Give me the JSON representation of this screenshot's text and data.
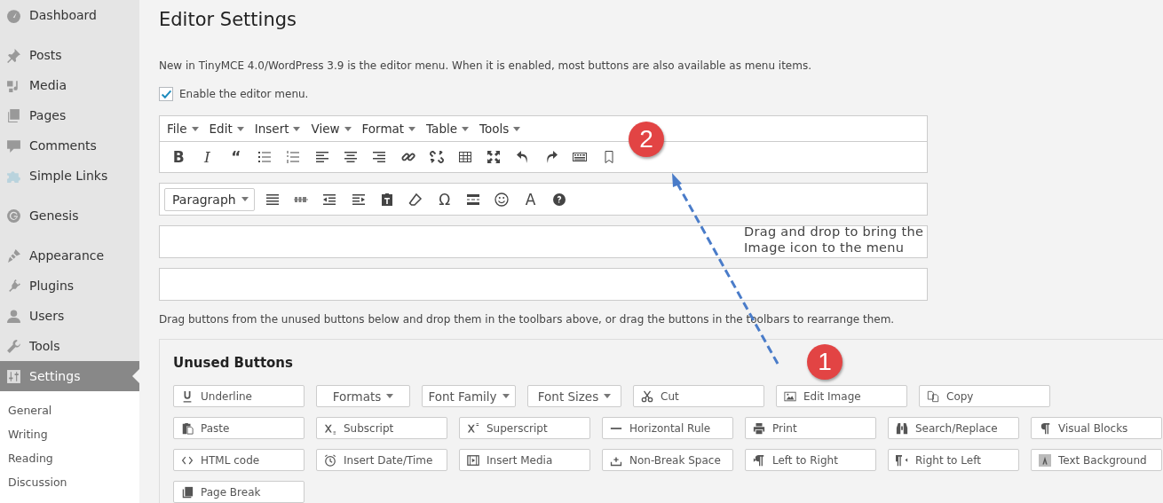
{
  "sidebar": {
    "groups": [
      [
        {
          "label": "Dashboard",
          "selected": false
        }
      ],
      [
        {
          "label": "Posts",
          "selected": false
        },
        {
          "label": "Media",
          "selected": false
        },
        {
          "label": "Pages",
          "selected": false
        },
        {
          "label": "Comments",
          "selected": false
        },
        {
          "label": "Simple Links",
          "selected": false
        }
      ],
      [
        {
          "label": "Genesis",
          "selected": false
        }
      ],
      [
        {
          "label": "Appearance",
          "selected": false
        },
        {
          "label": "Plugins",
          "selected": false
        },
        {
          "label": "Users",
          "selected": false
        },
        {
          "label": "Tools",
          "selected": false
        },
        {
          "label": "Settings",
          "selected": true
        }
      ]
    ],
    "submenu": [
      {
        "label": "General",
        "selected": false
      },
      {
        "label": "Writing",
        "selected": false
      },
      {
        "label": "Reading",
        "selected": false
      },
      {
        "label": "Discussion",
        "selected": false
      }
    ]
  },
  "page": {
    "title": "Editor Settings",
    "description": "New in TinyMCE 4.0/WordPress 3.9 is the editor menu. When it is enabled, most buttons are also available as menu items.",
    "enable_menu": {
      "label": "Enable the editor menu.",
      "checked": true
    },
    "menubar": [
      "File",
      "Edit",
      "Insert",
      "View",
      "Format",
      "Table",
      "Tools"
    ],
    "toolbar_1": [
      {
        "kind": "glyph",
        "text": "B"
      },
      {
        "kind": "glyph",
        "text": "I"
      },
      {
        "kind": "glyph",
        "text": "“"
      },
      {
        "kind": "icon"
      },
      {
        "kind": "icon"
      },
      {
        "kind": "icon"
      },
      {
        "kind": "icon"
      },
      {
        "kind": "icon"
      },
      {
        "kind": "icon"
      },
      {
        "kind": "icon"
      },
      {
        "kind": "icon"
      },
      {
        "kind": "icon"
      },
      {
        "kind": "icon"
      },
      {
        "kind": "icon"
      },
      {
        "kind": "icon"
      },
      {
        "kind": "icon"
      }
    ],
    "toolbar_2": [
      {
        "kind": "select",
        "text": "Paragraph"
      },
      {
        "kind": "icon"
      },
      {
        "kind": "icon"
      },
      {
        "kind": "icon"
      },
      {
        "kind": "icon"
      },
      {
        "kind": "icon"
      },
      {
        "kind": "icon"
      },
      {
        "kind": "glyph",
        "text": "Ω"
      },
      {
        "kind": "icon"
      },
      {
        "kind": "icon"
      },
      {
        "kind": "glyph",
        "text": "A"
      },
      {
        "kind": "icon"
      }
    ],
    "drag_hint": "Drag buttons from the unused buttons below and drop them in the toolbars above, or drag the buttons in the toolbars to rearrange them.",
    "unused": {
      "title": "Unused Buttons",
      "buttons": [
        {
          "kind": "button",
          "label": "Underline"
        },
        {
          "kind": "dropdown",
          "label": "Formats"
        },
        {
          "kind": "dropdown",
          "label": "Font Family"
        },
        {
          "kind": "dropdown",
          "label": "Font Sizes"
        },
        {
          "kind": "button",
          "label": "Cut"
        },
        {
          "kind": "button",
          "label": "Edit Image"
        },
        {
          "kind": "button",
          "label": "Copy"
        },
        {
          "kind": "button",
          "label": "Paste"
        },
        {
          "kind": "button",
          "label": "Subscript"
        },
        {
          "kind": "button",
          "label": "Superscript"
        },
        {
          "kind": "button",
          "label": "Horizontal Rule"
        },
        {
          "kind": "button",
          "label": "Print"
        },
        {
          "kind": "button",
          "label": "Search/Replace"
        },
        {
          "kind": "button",
          "label": "Visual Blocks"
        },
        {
          "kind": "button",
          "label": "HTML code"
        },
        {
          "kind": "button",
          "label": "Insert Date/Time"
        },
        {
          "kind": "button",
          "label": "Insert Media"
        },
        {
          "kind": "button",
          "label": "Non-Break Space"
        },
        {
          "kind": "button",
          "label": "Left to Right"
        },
        {
          "kind": "button",
          "label": "Right to Left"
        },
        {
          "kind": "button",
          "label": "Text Background"
        },
        {
          "kind": "button",
          "label": "Page Break"
        }
      ]
    }
  },
  "annotations": {
    "note": "Drag and drop to bring the Image icon to the menu",
    "badges": [
      "2",
      "1"
    ]
  }
}
